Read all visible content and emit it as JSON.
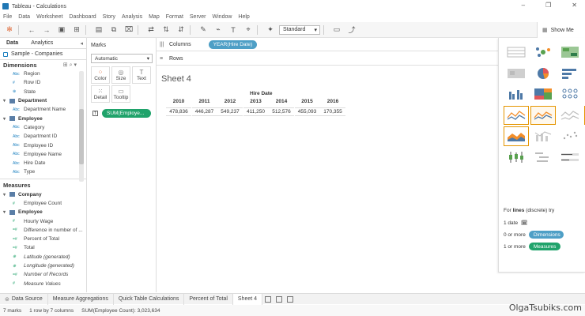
{
  "window": {
    "title": "Tableau - Calculations"
  },
  "menu": [
    "File",
    "Data",
    "Worksheet",
    "Dashboard",
    "Story",
    "Analysis",
    "Map",
    "Format",
    "Server",
    "Window",
    "Help"
  ],
  "toolbar": {
    "fit_select": "Standard",
    "show_me_label": "Show Me"
  },
  "data_pane": {
    "tabs": [
      "Data",
      "Analytics"
    ],
    "datasource": "Sample - Companies",
    "dimensions_label": "Dimensions",
    "dimensions": [
      {
        "type": "Abc",
        "name": "Region"
      },
      {
        "type": "#",
        "name": "Row ID"
      },
      {
        "type": "⊕",
        "name": "State"
      },
      {
        "group": true,
        "name": "Department"
      },
      {
        "type": "Abc",
        "name": "Department Name"
      },
      {
        "group": true,
        "name": "Employee"
      },
      {
        "type": "Abc",
        "name": "Category"
      },
      {
        "type": "Abc",
        "name": "Department ID"
      },
      {
        "type": "Abc",
        "name": "Employee ID"
      },
      {
        "type": "Abc",
        "name": "Employee Name"
      },
      {
        "type": "Abc",
        "name": "Hire Date"
      },
      {
        "type": "Abc",
        "name": "Type"
      }
    ],
    "measures_label": "Measures",
    "measures": [
      {
        "group": true,
        "name": "Company"
      },
      {
        "type": "#",
        "name": "Employee Count"
      },
      {
        "group": true,
        "name": "Employee"
      },
      {
        "type": "#",
        "name": "Hourly Wage"
      },
      {
        "type": "=#",
        "name": "Difference in number of ..."
      },
      {
        "type": "=#",
        "name": "Percent of Total"
      },
      {
        "type": "=#",
        "name": "Total"
      },
      {
        "type": "⊕",
        "name": "Latitude (generated)",
        "italic": true
      },
      {
        "type": "⊕",
        "name": "Longitude (generated)",
        "italic": true
      },
      {
        "type": "=#",
        "name": "Number of Records",
        "italic": true
      },
      {
        "type": "#",
        "name": "Measure Values",
        "italic": true
      }
    ]
  },
  "marks_card": {
    "label": "Marks",
    "mark_type": "Automatic",
    "buttons": [
      "Color",
      "Size",
      "Text",
      "Detail",
      "Tooltip"
    ],
    "text_pill": "SUM(Employe..."
  },
  "shelves": {
    "columns_label": "Columns",
    "columns_pill": "YEAR(Hire Date)",
    "rows_label": "Rows"
  },
  "view": {
    "sheet_title": "Sheet 4",
    "column_header": "Hire Date",
    "years": [
      "2010",
      "2011",
      "2012",
      "2013",
      "2014",
      "2015",
      "2016"
    ],
    "values": [
      "478,836",
      "446,287",
      "549,237",
      "411,250",
      "512,576",
      "455,093",
      "170,355"
    ]
  },
  "show_me": {
    "hint_prefix": "For",
    "hint_bold": "lines",
    "hint_suffix": "(discrete) try",
    "req1": "1 date",
    "req2_prefix": "0 or more",
    "req2_pill": "Dimensions",
    "req3_prefix": "1 or more",
    "req3_pill": "Measures"
  },
  "sheet_tabs": [
    "Data Source",
    "Measure Aggregations",
    "Quick Table Calculations",
    "Percent of Total",
    "Sheet 4"
  ],
  "status": {
    "marks": "7 marks",
    "rows_cols": "1 row by 7 columns",
    "sum": "SUM(Employee Count): 3,023,634"
  },
  "watermark": "OlgaTsubiks.com",
  "colors": {
    "dimension_pill": "#4e9fc6",
    "measure_pill": "#20a36b",
    "highlight": "#e59500"
  }
}
